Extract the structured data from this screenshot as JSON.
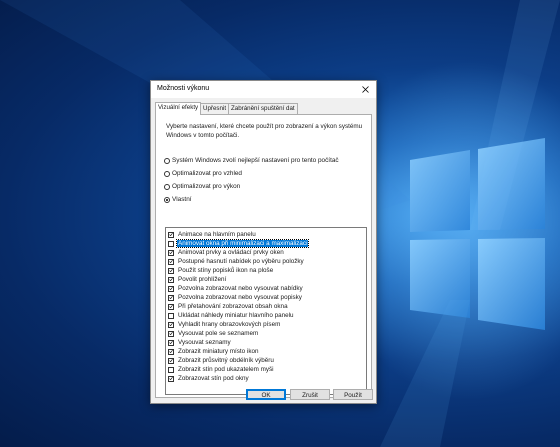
{
  "dialog": {
    "title": "Možnosti výkonu",
    "tabs": [
      {
        "label": "Vizuální efekty",
        "active": true
      },
      {
        "label": "Upřesnit",
        "active": false
      },
      {
        "label": "Zabránění spuštění dat",
        "active": false
      }
    ],
    "description": "Vyberte nastavení, které chcete použít pro zobrazení a výkon systému Windows v tomto počítači.",
    "radios": [
      {
        "label": "Systém Windows zvolí nejlepší nastavení pro tento počítač",
        "selected": false
      },
      {
        "label": "Optimalizovat pro vzhled",
        "selected": false
      },
      {
        "label": "Optimalizovat pro výkon",
        "selected": false
      },
      {
        "label": "Vlastní",
        "selected": true
      }
    ],
    "options": [
      {
        "label": "Animace na hlavním panelu",
        "checked": true,
        "selected": false
      },
      {
        "label": "Animovat okna při minimalizaci a maximalizaci",
        "checked": false,
        "selected": true
      },
      {
        "label": "Animovat prvky a ovládací prvky oken",
        "checked": true,
        "selected": false
      },
      {
        "label": "Postupné hasnutí nabídek po výběru položky",
        "checked": true,
        "selected": false
      },
      {
        "label": "Použít stíny popisků ikon na ploše",
        "checked": true,
        "selected": false
      },
      {
        "label": "Povolit prohlížení",
        "checked": true,
        "selected": false
      },
      {
        "label": "Pozvolna zobrazovat nebo vysouvat nabídky",
        "checked": true,
        "selected": false
      },
      {
        "label": "Pozvolna zobrazovat nebo vysouvat popisky",
        "checked": true,
        "selected": false
      },
      {
        "label": "Při přetahování zobrazovat obsah okna",
        "checked": true,
        "selected": false
      },
      {
        "label": "Ukládat náhledy miniatur hlavního panelu",
        "checked": false,
        "selected": false
      },
      {
        "label": "Vyhladit hrany obrazovkových písem",
        "checked": true,
        "selected": false
      },
      {
        "label": "Vysouvat pole se seznamem",
        "checked": true,
        "selected": false
      },
      {
        "label": "Vysouvat seznamy",
        "checked": true,
        "selected": false
      },
      {
        "label": "Zobrazit miniatury místo ikon",
        "checked": true,
        "selected": false
      },
      {
        "label": "Zobrazit průsvitný obdélník výběru",
        "checked": true,
        "selected": false
      },
      {
        "label": "Zobrazit stín pod ukazatelem myši",
        "checked": false,
        "selected": false
      },
      {
        "label": "Zobrazovat stín pod okny",
        "checked": true,
        "selected": false
      }
    ],
    "buttons": {
      "ok": "OK",
      "cancel": "Zrušit",
      "apply": "Použít"
    }
  },
  "colors": {
    "accent": "#0078d7",
    "wallpaper_light": "#3f9ae8",
    "wallpaper_dark": "#041c4a"
  },
  "icons": {
    "close": "close-icon",
    "check": "check-icon"
  }
}
